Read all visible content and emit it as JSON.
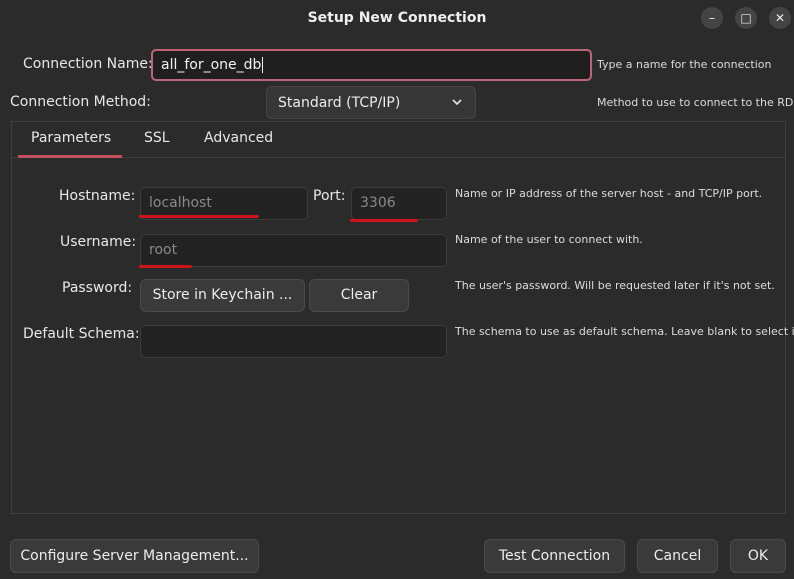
{
  "window": {
    "title": "Setup New Connection",
    "minimize": "–",
    "maximize": "□",
    "close": "✕"
  },
  "connection_name": {
    "label": "Connection Name:",
    "value": "all_for_one_db",
    "hint": "Type a name for the connection"
  },
  "connection_method": {
    "label": "Connection Method:",
    "value": "Standard (TCP/IP)",
    "hint": "Method to use to connect to the RDBMS"
  },
  "tabs": [
    {
      "label": "Parameters",
      "active": true
    },
    {
      "label": "SSL",
      "active": false
    },
    {
      "label": "Advanced",
      "active": false
    }
  ],
  "parameters": {
    "hostname": {
      "label": "Hostname:",
      "value": "localhost"
    },
    "port": {
      "label": "Port:",
      "value": "3306"
    },
    "host_hint": "Name or IP address of the server host - and TCP/IP port.",
    "username": {
      "label": "Username:",
      "value": "root",
      "hint": "Name of the user to connect with."
    },
    "password": {
      "label": "Password:",
      "store_button": "Store in Keychain ...",
      "clear_button": "Clear",
      "hint": "The user's password. Will be requested later if it's not set."
    },
    "default_schema": {
      "label": "Default Schema:",
      "value": "",
      "hint": "The schema to use as default schema. Leave blank to select it later."
    }
  },
  "footer": {
    "configure_button": "Configure Server Management...",
    "test_button": "Test Connection",
    "cancel_button": "Cancel",
    "ok_button": "OK"
  },
  "colors": {
    "accent": "#c0505e",
    "annotation_red": "#d0121a"
  }
}
